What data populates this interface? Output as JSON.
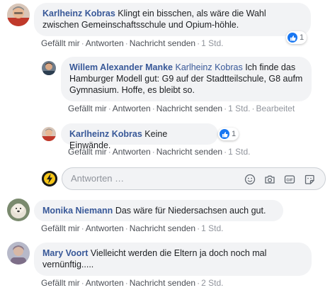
{
  "comments": [
    {
      "author": "Karlheinz Kobras",
      "text": "Klingt ein bisschen, als wäre die Wahl zwischen Gemeinschaftsschule und Opium-höhle.",
      "reaction_count": "1",
      "actions": [
        "Gefällt mir",
        "Antworten",
        "Nachricht senden"
      ],
      "time": "1 Std."
    },
    {
      "author": "Willem Alexander Manke",
      "mention": "Karlheinz Kobras",
      "text": "Ich finde das Hamburger Modell gut: G9 auf der Stadtteilschule, G8 aufm Gymnasium. Hoffe, es bleibt so.",
      "actions": [
        "Gefällt mir",
        "Antworten",
        "Nachricht senden"
      ],
      "time": "1 Std.",
      "edited": "Bearbeitet"
    },
    {
      "author": "Karlheinz Kobras",
      "text": "Keine Einwände.",
      "reaction_count": "1",
      "actions": [
        "Gefällt mir",
        "Antworten",
        "Nachricht senden"
      ],
      "time": "1 Std."
    },
    {
      "author": "Monika Niemann",
      "text": "Das wäre für Niedersachsen auch gut.",
      "actions": [
        "Gefällt mir",
        "Antworten",
        "Nachricht senden"
      ],
      "time": "1 Std."
    },
    {
      "author": "Mary Voort",
      "text": "Vielleicht werden die Eltern ja doch noch mal vernünftig.....",
      "actions": [
        "Gefällt mir",
        "Antworten",
        "Nachricht senden"
      ],
      "time": "2 Std."
    }
  ],
  "reply_box": {
    "placeholder": "Antworten …",
    "icons": [
      "smiley-icon",
      "camera-icon",
      "gif-icon",
      "sticker-icon"
    ]
  },
  "colors": {
    "link": "#385898",
    "bubble": "#f2f3f5",
    "like_blue": "#1877f2",
    "meta": "#90949c"
  }
}
